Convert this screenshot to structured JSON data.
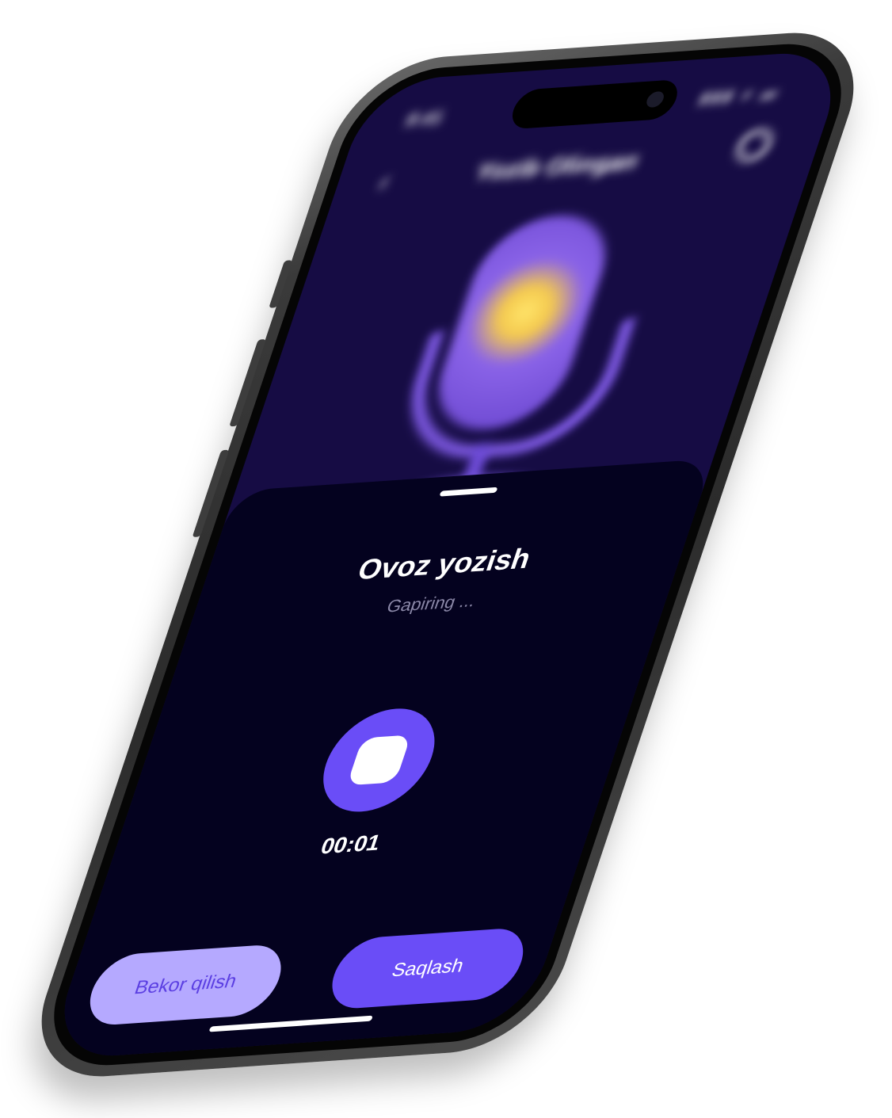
{
  "status_bar": {
    "time": "9:41",
    "icons": "▮▮▮ ● ▬"
  },
  "background_app": {
    "back_icon": "chevron-left-icon",
    "title": "Yozib Olingan",
    "search_icon": "search-icon",
    "hero_icon": "microphone-icon"
  },
  "sheet": {
    "title": "Ovoz yozish",
    "subtitle": "Gapiring ...",
    "stop_icon": "stop-icon",
    "timer": "00:01",
    "cancel_label": "Bekor qilish",
    "save_label": "Saqlash"
  },
  "colors": {
    "accent": "#6a4df7",
    "accent_light": "#b5a9ff",
    "sheet_background": "#04021f",
    "screen_background": "#160c44"
  }
}
